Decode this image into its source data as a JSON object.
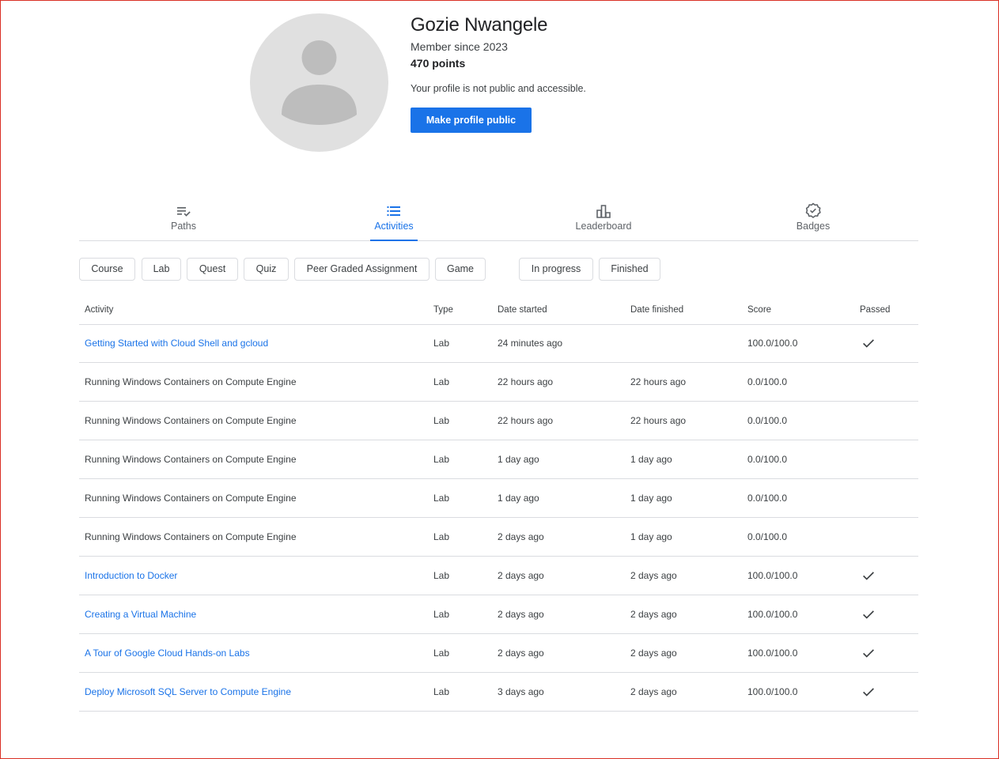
{
  "profile": {
    "name": "Gozie Nwangele",
    "member_since": "Member since 2023",
    "points": "470 points",
    "visibility_notice": "Your profile is not public and accessible.",
    "make_public_label": "Make profile public"
  },
  "tabs": [
    {
      "label": "Paths",
      "icon": "paths-icon",
      "active": false
    },
    {
      "label": "Activities",
      "icon": "activities-list-icon",
      "active": true
    },
    {
      "label": "Leaderboard",
      "icon": "leaderboard-icon",
      "active": false
    },
    {
      "label": "Badges",
      "icon": "badge-icon",
      "active": false
    }
  ],
  "filters": {
    "type_chips": [
      "Course",
      "Lab",
      "Quest",
      "Quiz",
      "Peer Graded Assignment",
      "Game"
    ],
    "status_chips": [
      "In progress",
      "Finished"
    ]
  },
  "table": {
    "headers": {
      "activity": "Activity",
      "type": "Type",
      "date_started": "Date started",
      "date_finished": "Date finished",
      "score": "Score",
      "passed": "Passed"
    },
    "rows": [
      {
        "activity": "Getting Started with Cloud Shell and gcloud",
        "is_link": true,
        "type": "Lab",
        "date_started": "24 minutes ago",
        "date_finished": "",
        "score": "100.0/100.0",
        "passed": true
      },
      {
        "activity": "Running Windows Containers on Compute Engine",
        "is_link": false,
        "type": "Lab",
        "date_started": "22 hours ago",
        "date_finished": "22 hours ago",
        "score": "0.0/100.0",
        "passed": false
      },
      {
        "activity": "Running Windows Containers on Compute Engine",
        "is_link": false,
        "type": "Lab",
        "date_started": "22 hours ago",
        "date_finished": "22 hours ago",
        "score": "0.0/100.0",
        "passed": false
      },
      {
        "activity": "Running Windows Containers on Compute Engine",
        "is_link": false,
        "type": "Lab",
        "date_started": "1 day ago",
        "date_finished": "1 day ago",
        "score": "0.0/100.0",
        "passed": false
      },
      {
        "activity": "Running Windows Containers on Compute Engine",
        "is_link": false,
        "type": "Lab",
        "date_started": "1 day ago",
        "date_finished": "1 day ago",
        "score": "0.0/100.0",
        "passed": false
      },
      {
        "activity": "Running Windows Containers on Compute Engine",
        "is_link": false,
        "type": "Lab",
        "date_started": "2 days ago",
        "date_finished": "1 day ago",
        "score": "0.0/100.0",
        "passed": false
      },
      {
        "activity": "Introduction to Docker",
        "is_link": true,
        "type": "Lab",
        "date_started": "2 days ago",
        "date_finished": "2 days ago",
        "score": "100.0/100.0",
        "passed": true
      },
      {
        "activity": "Creating a Virtual Machine",
        "is_link": true,
        "type": "Lab",
        "date_started": "2 days ago",
        "date_finished": "2 days ago",
        "score": "100.0/100.0",
        "passed": true
      },
      {
        "activity": "A Tour of Google Cloud Hands-on Labs",
        "is_link": true,
        "type": "Lab",
        "date_started": "2 days ago",
        "date_finished": "2 days ago",
        "score": "100.0/100.0",
        "passed": true
      },
      {
        "activity": "Deploy Microsoft SQL Server to Compute Engine",
        "is_link": true,
        "type": "Lab",
        "date_started": "3 days ago",
        "date_finished": "2 days ago",
        "score": "100.0/100.0",
        "passed": true
      }
    ]
  },
  "colors": {
    "accent": "#1a73e8",
    "divider": "#dadce0",
    "avatar_bg": "#e0e0e0",
    "avatar_fg": "#bdbdbd",
    "frame": "#d93025"
  }
}
